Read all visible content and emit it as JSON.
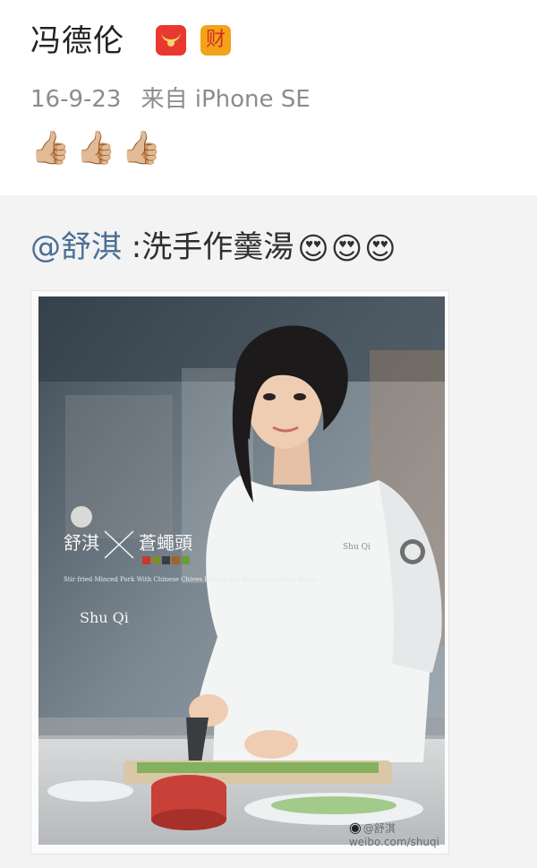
{
  "post": {
    "username": "冯德伦",
    "badge_icons": [
      "red-packet-icon",
      "fortune-icon"
    ],
    "fortune_badge_text": "财",
    "date": "16-9-23",
    "source": "来自 iPhone SE",
    "reaction_emojis": [
      "👍🏼",
      "👍🏼",
      "👍🏼"
    ]
  },
  "repost": {
    "mention": "@舒淇",
    "text": " :洗手作羹湯",
    "emojis": [
      "😍",
      "😍",
      "😍"
    ]
  },
  "photo": {
    "overlay_title_left": "舒淇",
    "overlay_title_right": "蒼蠅頭",
    "overlay_subtitle": "Stir fried Minced Pork With Chinese Chives Flower and Fermented Black Beans",
    "overlay_byline": "Shu Qi",
    "coat_embroidery": "Shu Qi",
    "watermark_name": "@舒淇",
    "watermark_url": "weibo.com/shuqi"
  },
  "colors": {
    "mention": "#4a6f95",
    "meta_text": "#8c8c8c",
    "background": "#f3f3f3"
  }
}
